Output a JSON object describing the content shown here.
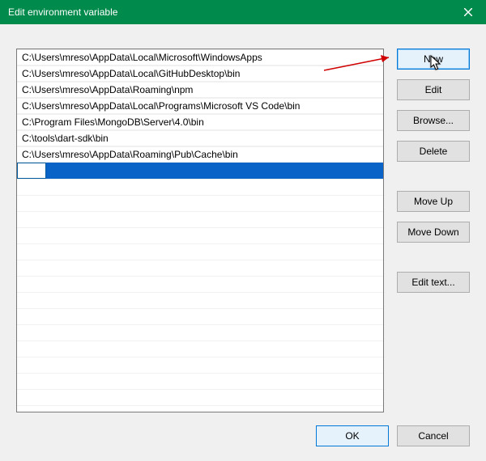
{
  "window": {
    "title": "Edit environment variable",
    "close_label": "Close"
  },
  "paths": [
    "C:\\Users\\mreso\\AppData\\Local\\Microsoft\\WindowsApps",
    "C:\\Users\\mreso\\AppData\\Local\\GitHubDesktop\\bin",
    "C:\\Users\\mreso\\AppData\\Roaming\\npm",
    "C:\\Users\\mreso\\AppData\\Local\\Programs\\Microsoft VS Code\\bin",
    "C:\\Program Files\\MongoDB\\Server\\4.0\\bin",
    "C:\\tools\\dart-sdk\\bin",
    "C:\\Users\\mreso\\AppData\\Roaming\\Pub\\Cache\\bin"
  ],
  "new_entry_value": "",
  "buttons": {
    "new": "New",
    "edit": "Edit",
    "browse": "Browse...",
    "delete": "Delete",
    "move_up": "Move Up",
    "move_down": "Move Down",
    "edit_text": "Edit text...",
    "ok": "OK",
    "cancel": "Cancel"
  }
}
